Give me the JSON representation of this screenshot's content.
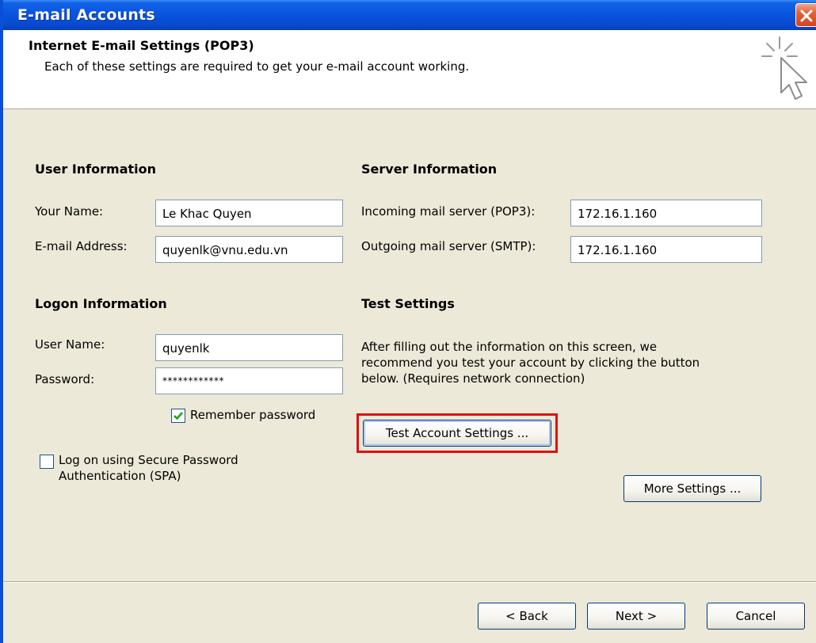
{
  "window": {
    "title": "E-mail Accounts"
  },
  "header": {
    "title": "Internet E-mail Settings (POP3)",
    "subtitle": "Each of these settings are required to get your e-mail account working."
  },
  "user_info": {
    "heading": "User Information",
    "name_label": "Your Name:",
    "name_value": "Le Khac Quyen",
    "email_label": "E-mail Address:",
    "email_value": "quyenlk@vnu.edu.vn"
  },
  "server_info": {
    "heading": "Server Information",
    "incoming_label": "Incoming mail server (POP3):",
    "incoming_value": "172.16.1.160",
    "outgoing_label": "Outgoing mail server (SMTP):",
    "outgoing_value": "172.16.1.160"
  },
  "logon_info": {
    "heading": "Logon Information",
    "username_label": "User Name:",
    "username_value": "quyenlk",
    "password_label": "Password:",
    "password_value": "************",
    "remember_label": "Remember password",
    "remember_checked": true,
    "spa_label_line1": "Log on using Secure Password",
    "spa_label_line2": "Authentication (SPA)",
    "spa_checked": false
  },
  "test_settings": {
    "heading": "Test Settings",
    "description": "After filling out the information on this screen, we recommend you test your account by clicking the button below. (Requires network connection)",
    "test_button": "Test Account Settings ...",
    "more_button": "More Settings ..."
  },
  "footer": {
    "back_button": "< Back",
    "next_button": "Next >",
    "cancel_button": "Cancel"
  },
  "colors": {
    "title_bar": "#0a55de",
    "dialog_bg": "#ece9d8",
    "highlight": "#e01010"
  },
  "icons": [
    "close-icon",
    "wizard-cursor-icon",
    "checkmark-icon"
  ]
}
